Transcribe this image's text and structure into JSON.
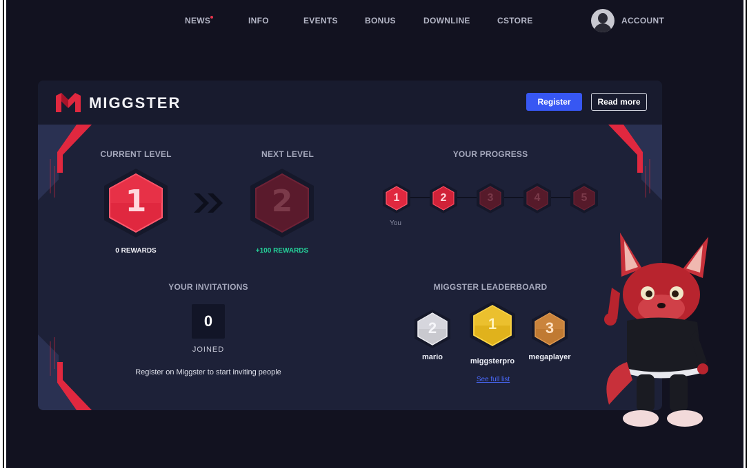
{
  "nav": {
    "items": [
      {
        "label": "NEWS"
      },
      {
        "label": "INFO"
      },
      {
        "label": "EVENTS"
      },
      {
        "label": "BONUS"
      },
      {
        "label": "DOWNLINE"
      },
      {
        "label": "CSTORE"
      }
    ],
    "account_label": "ACCOUNT",
    "news_badge_color": "#e8354d"
  },
  "header": {
    "brand": "MIGGSTER",
    "register_label": "Register",
    "read_more_label": "Read more"
  },
  "levels": {
    "current_title": "CURRENT LEVEL",
    "current_value": "1",
    "current_rewards": "0 REWARDS",
    "next_title": "NEXT LEVEL",
    "next_value": "2",
    "next_rewards": "+100 REWARDS"
  },
  "progress": {
    "title": "YOUR PROGRESS",
    "steps": [
      "1",
      "2",
      "3",
      "4",
      "5"
    ],
    "you_label": "You"
  },
  "invitations": {
    "title": "YOUR INVITATIONS",
    "count": "0",
    "joined_label": "JOINED",
    "hint": "Register on Miggster to start inviting people"
  },
  "leaderboard": {
    "title": "MIGGSTER LEADERBOARD",
    "entries": [
      {
        "rank": "2",
        "name": "mario",
        "medal": "silver"
      },
      {
        "rank": "1",
        "name": "miggsterpro",
        "medal": "gold"
      },
      {
        "rank": "3",
        "name": "megaplayer",
        "medal": "bronze"
      }
    ],
    "see_full_list": "See full list"
  },
  "colors": {
    "accent_red": "#e0283f",
    "accent_blue": "#3757f3",
    "reward_green": "#25d39a",
    "background": "#121220",
    "card": "#1d2138"
  }
}
